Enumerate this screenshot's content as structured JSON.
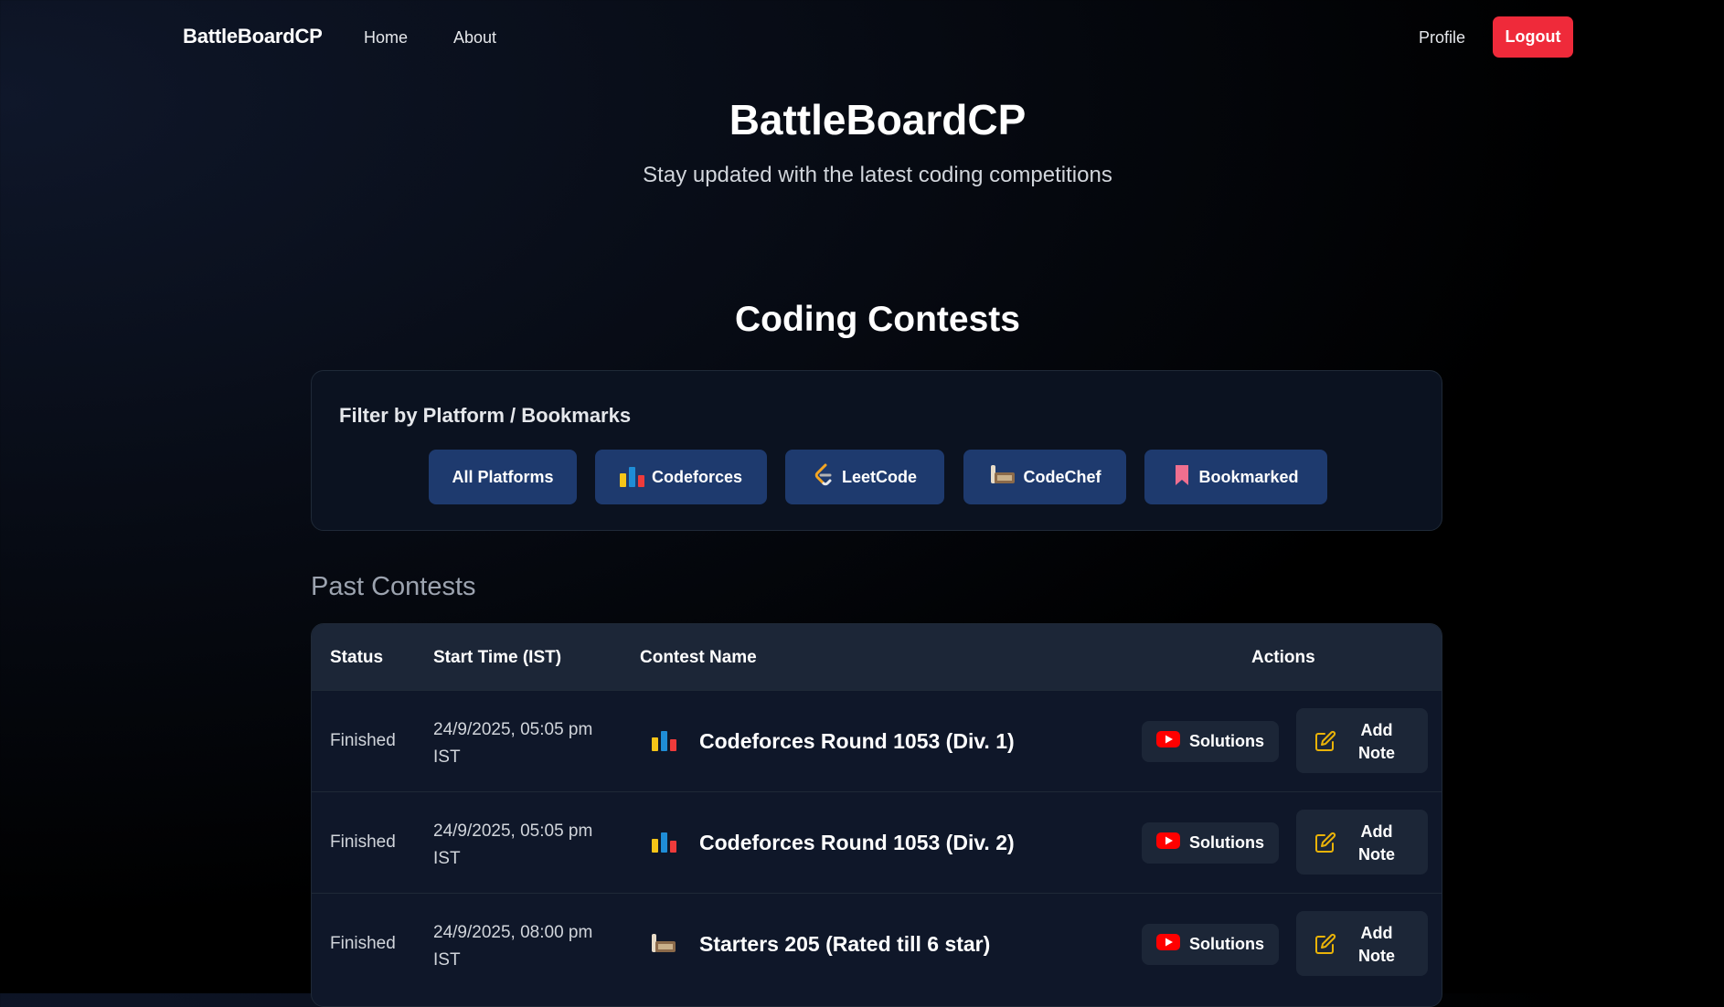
{
  "nav": {
    "brand": "BattleBoardCP",
    "home": "Home",
    "about": "About",
    "profile": "Profile",
    "logout": "Logout"
  },
  "hero": {
    "title": "BattleBoardCP",
    "subtitle": "Stay updated with the latest coding competitions"
  },
  "section_title": "Coding Contests",
  "filter": {
    "heading": "Filter by Platform / Bookmarks",
    "buttons": [
      {
        "label": "All Platforms",
        "icon": "none"
      },
      {
        "label": "Codeforces",
        "icon": "codeforces-icon"
      },
      {
        "label": "LeetCode",
        "icon": "leetcode-icon"
      },
      {
        "label": "CodeChef",
        "icon": "codechef-icon"
      },
      {
        "label": "Bookmarked",
        "icon": "bookmark-icon"
      }
    ]
  },
  "past_title": "Past Contests",
  "table": {
    "headers": {
      "status": "Status",
      "start": "Start Time (IST)",
      "name": "Contest Name",
      "actions": "Actions"
    },
    "solutions_label": "Solutions",
    "note_label": "Add Note",
    "rows": [
      {
        "status": "Finished",
        "time": "24/9/2025, 05:05 pm IST",
        "platform": "codeforces-icon",
        "name": "Codeforces Round 1053 (Div. 1)"
      },
      {
        "status": "Finished",
        "time": "24/9/2025, 05:05 pm IST",
        "platform": "codeforces-icon",
        "name": "Codeforces Round 1053 (Div. 2)"
      },
      {
        "status": "Finished",
        "time": "24/9/2025, 08:00 pm IST",
        "platform": "codechef-icon",
        "name": "Starters 205 (Rated till 6 star)"
      }
    ]
  },
  "colors": {
    "accent_red": "#ef2a3a",
    "filter_button": "#1e3a6e",
    "card": "#0b1220",
    "youtube": "#ff0000",
    "note_icon": "#eab308"
  }
}
